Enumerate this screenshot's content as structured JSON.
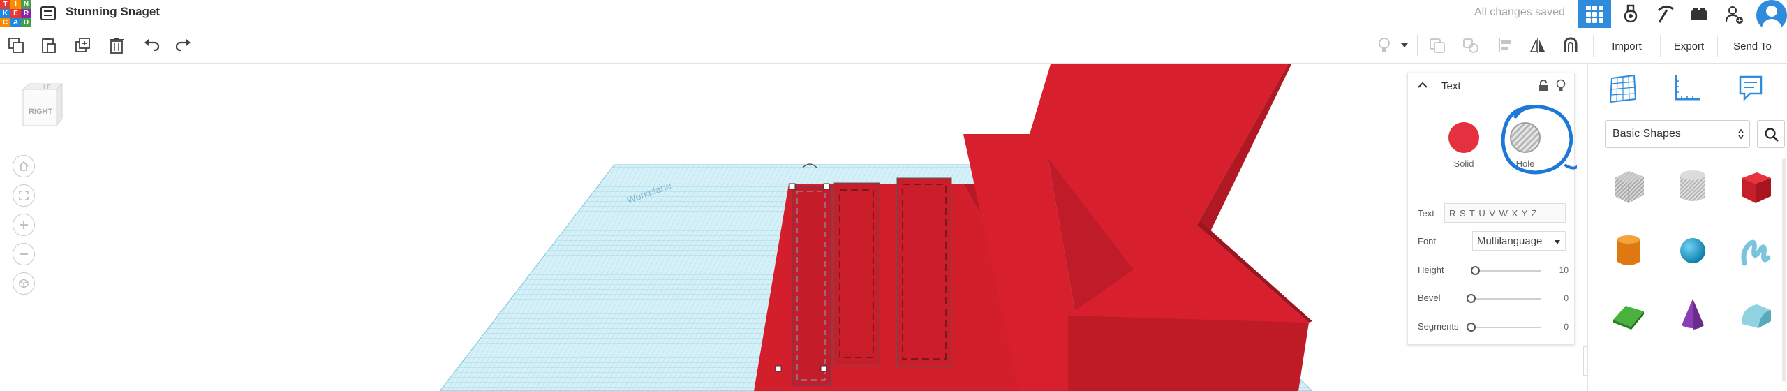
{
  "app": {
    "logo_letters": [
      "T",
      "I",
      "N",
      "K",
      "E",
      "R",
      "C",
      "A",
      "D"
    ],
    "logo_colors": [
      "#e53935",
      "#fb8c00",
      "#43a047",
      "#1e88e5",
      "#e53935",
      "#8e24aa",
      "#fb8c00",
      "#1e88e5",
      "#43a047"
    ],
    "project_title": "Stunning Snaget",
    "save_status": "All changes saved",
    "accent_color": "#2f8bdc"
  },
  "header": {
    "icons": [
      "grid-view-icon",
      "tinker-lab-icon",
      "pickaxe-icon",
      "bricks-icon",
      "add-user-icon",
      "avatar-icon"
    ]
  },
  "toolbar": {
    "left_icons": [
      "copy-icon",
      "paste-icon",
      "duplicate-icon",
      "delete-icon",
      "undo-icon",
      "redo-icon"
    ],
    "right_icons": [
      "light-bulb-icon",
      "dropdown-icon",
      "group-icon",
      "ungroup-icon",
      "align-icon",
      "mirror-icon",
      "magnet-icon"
    ],
    "import_label": "Import",
    "export_label": "Export",
    "send_to_label": "Send To"
  },
  "viewport": {
    "view_cube_face": "RIGHT",
    "view_cube_top": "LE",
    "nav_buttons": [
      "home-view",
      "fit-view",
      "zoom-in",
      "zoom-out",
      "perspective-toggle"
    ],
    "grid_label": "Workplane",
    "solid_color": "#d81f2e",
    "grid_color": "#bfe6f2"
  },
  "inspector": {
    "title": "Text",
    "solid_label": "Solid",
    "hole_label": "Hole",
    "solid_color": "#e53040",
    "annotation_color": "#1e78d6",
    "text_label": "Text",
    "text_value": "R S T U V W X Y Z",
    "font_label": "Font",
    "font_value": "Multilanguage",
    "height_label": "Height",
    "height_value": "10",
    "bevel_label": "Bevel",
    "bevel_value": "0",
    "segments_label": "Segments",
    "segments_value": "0"
  },
  "shapes_panel": {
    "top_icons": [
      "workplane-grid-icon",
      "ruler-icon",
      "notes-icon"
    ],
    "library_label": "Basic Shapes",
    "shapes": [
      {
        "name": "box-hole",
        "color": "#bdbdbd"
      },
      {
        "name": "cylinder-hole",
        "color": "#c8c8c8"
      },
      {
        "name": "box",
        "color": "#d81f2e"
      },
      {
        "name": "cylinder",
        "color": "#f08a1c"
      },
      {
        "name": "sphere",
        "color": "#1a9bd0"
      },
      {
        "name": "scribble",
        "color": "#8fd0e8"
      },
      {
        "name": "roof",
        "color": "#3fa535"
      },
      {
        "name": "cone",
        "color": "#8c3fb8"
      },
      {
        "name": "round-roof",
        "color": "#7cc8d8"
      }
    ]
  }
}
